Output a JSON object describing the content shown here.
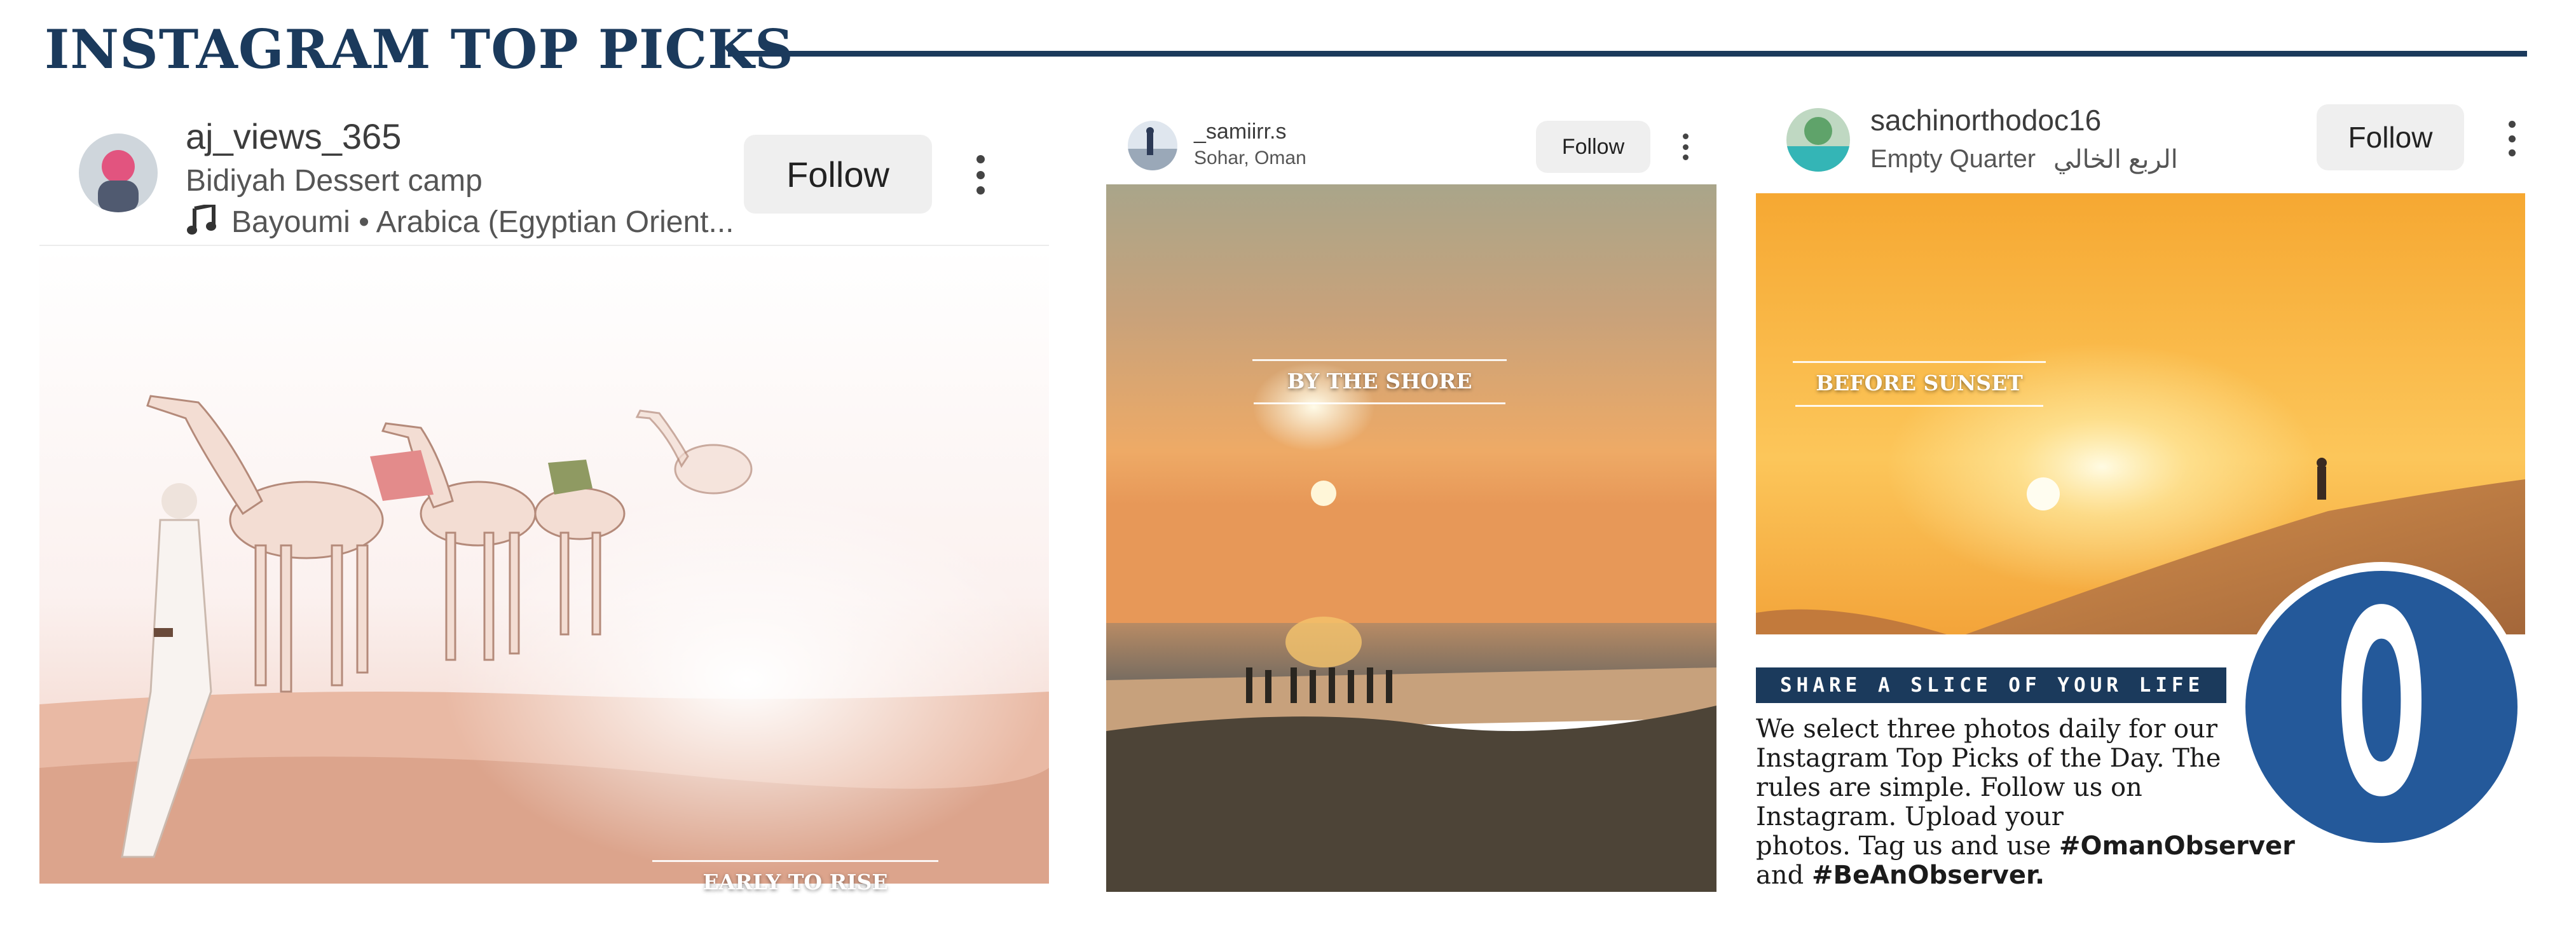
{
  "header": {
    "title": "INSTAGRAM TOP PICKS"
  },
  "posts": [
    {
      "username": "aj_views_365",
      "location": "Bidiyah Dessert camp",
      "music": "Bayoumi • Arabica (Egyptian Orient...",
      "follow_label": "Follow",
      "caption": "EARLY TO RISE"
    },
    {
      "username": "_samiirr.s",
      "location": "Sohar, Oman",
      "follow_label": "Follow",
      "caption": "BY THE SHORE"
    },
    {
      "username": "sachinorthodoc16",
      "location": "Empty Quarter",
      "location_arabic": "الربع الخالي",
      "follow_label": "Follow",
      "caption": "BEFORE SUNSET"
    }
  ],
  "promo": {
    "banner": "SHARE A SLICE OF YOUR LIFE",
    "lines": [
      "We select three photos daily for our",
      "Instagram Top Picks of the Day. The",
      "rules are simple. Follow us on",
      "Instagram. Upload your"
    ],
    "line5_prefix": "photos. Tag us and use ",
    "hashtag1": "#OmanObserver",
    "line6_prefix": "and ",
    "hashtag2": "#BeAnObserver.",
    "logo_letter": "O"
  },
  "colors": {
    "brand_navy": "#1b3a5c",
    "logo_blue": "#24599a"
  },
  "icons": [
    "music-note-icon",
    "more-options-icon"
  ]
}
